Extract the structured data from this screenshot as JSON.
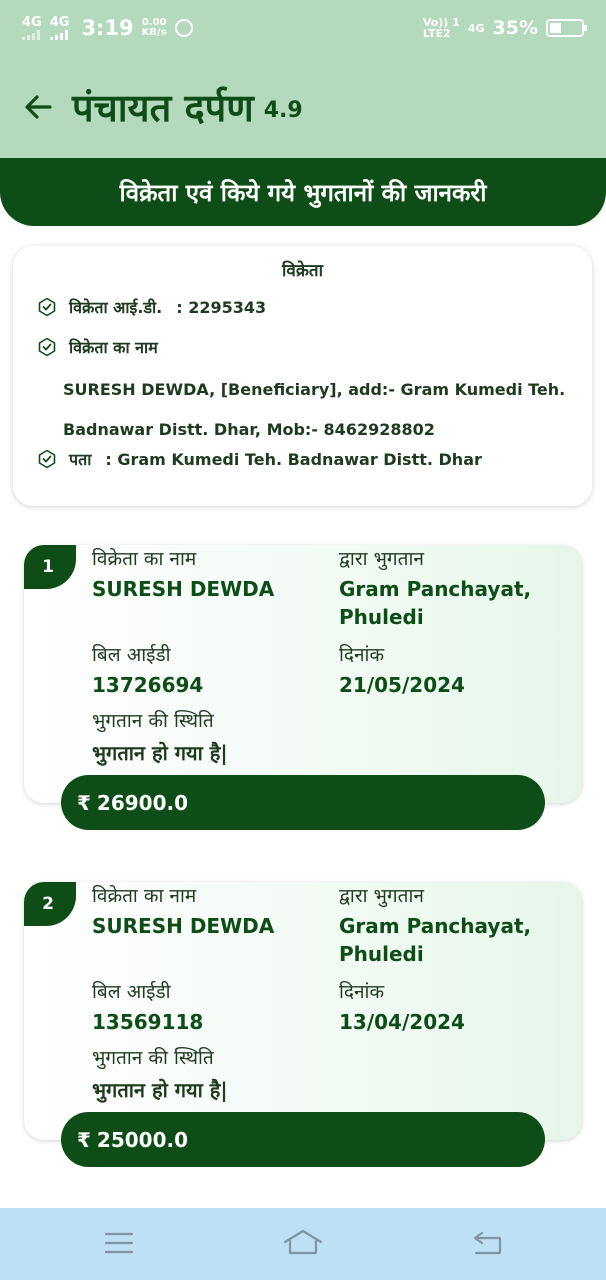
{
  "status_bar": {
    "signal1": "4G",
    "signal2": "4G",
    "time": "3:19",
    "net_speed_value": "0.00",
    "net_speed_unit": "KB/s",
    "volte_line1": "Vo)) 1",
    "volte_line2": "LTE2",
    "network2": "4G",
    "battery_percent": "35%",
    "battery_level": 0.35
  },
  "header": {
    "title": "पंचायत दर्पण",
    "version": "4.9"
  },
  "banner": {
    "text": "विक्रेता एवं किये गये भुगतानों की जानकरी"
  },
  "vendor": {
    "heading": "विक्रेता",
    "id_label": "विक्रेता आई.डी.",
    "id_value": ": 2295343",
    "name_label": "विक्रेता का नाम",
    "name_line1": "SURESH DEWDA, [Beneficiary], add:- Gram Kumedi Teh.",
    "name_line2": "Badnawar Distt. Dhar, Mob:- 8462928802",
    "address_label": "पता",
    "address_value": ": Gram Kumedi Teh. Badnawar Distt. Dhar"
  },
  "payments": [
    {
      "index": "1",
      "name_label": "विक्रेता का नाम",
      "name_value": "SURESH DEWDA",
      "paid_by_label": "द्वारा भुगतान",
      "paid_by_line1": "Gram Panchayat,",
      "paid_by_line2": "Phuledi",
      "bill_id_label": "बिल आईडी",
      "bill_id_value": "13726694",
      "date_label": "दिनांक",
      "date_value": "21/05/2024",
      "status_label": "भुगतान की स्थिति",
      "status_value": "भुगतान हो गया है|",
      "currency": "₹",
      "amount": "26900.0"
    },
    {
      "index": "2",
      "name_label": "विक्रेता का नाम",
      "name_value": "SURESH DEWDA",
      "paid_by_label": "द्वारा भुगतान",
      "paid_by_line1": "Gram Panchayat,",
      "paid_by_line2": "Phuledi",
      "bill_id_label": "बिल आईडी",
      "bill_id_value": "13569118",
      "date_label": "दिनांक",
      "date_value": "13/04/2024",
      "status_label": "भुगतान की स्थिति",
      "status_value": "भुगतान हो गया है|",
      "currency": "₹",
      "amount": "25000.0"
    }
  ],
  "nav": {
    "menu_icon": "menu-icon",
    "home_icon": "home-icon",
    "back_icon": "back-nav-icon"
  },
  "colors": {
    "header_bg": "#b5d9bd",
    "primary_dark": "#0e4d17",
    "nav_bg": "#bde0f5"
  }
}
